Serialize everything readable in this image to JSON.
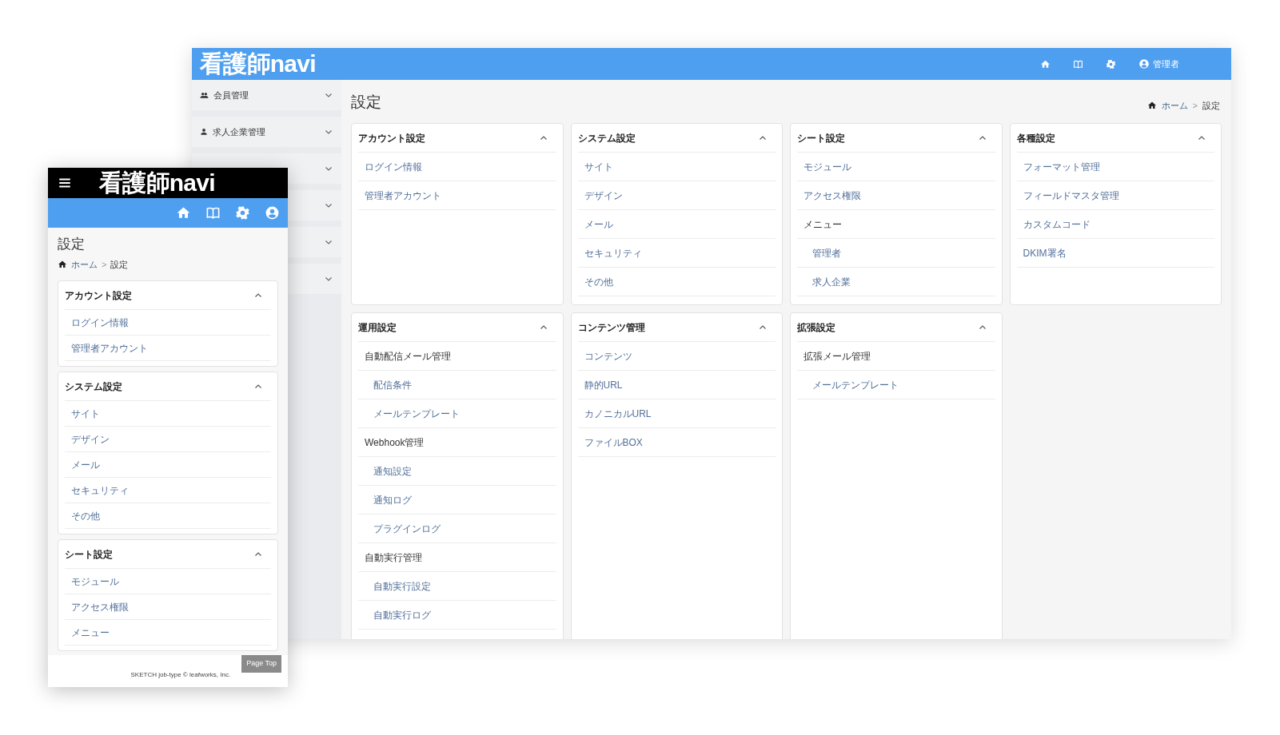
{
  "desktop": {
    "logo": "看護師navi",
    "user": "管理者",
    "sidebar": {
      "items": [
        {
          "label": "会員管理",
          "expanded": false
        },
        {
          "label": "求人企業管理",
          "expanded": false
        },
        {
          "expanded": false
        },
        {
          "expanded": false
        },
        {
          "expanded": false
        },
        {
          "expanded": false
        }
      ]
    },
    "page_title": "設定",
    "breadcrumb": [
      {
        "label": "ホーム",
        "kind": "home"
      },
      {
        "label": "設定",
        "kind": "current",
        "separator": ">"
      }
    ],
    "panels": [
      {
        "title": "アカウント設定",
        "expanded": true,
        "items": [
          {
            "label": "ログイン情報"
          },
          {
            "label": "管理者アカウント"
          }
        ]
      },
      {
        "title": "システム設定",
        "expanded": true,
        "items": [
          {
            "label": "サイト"
          },
          {
            "label": "デザイン"
          },
          {
            "label": "メール"
          },
          {
            "label": "セキュリティ"
          },
          {
            "label": "その他"
          }
        ]
      },
      {
        "title": "シート設定",
        "expanded": true,
        "items": [
          {
            "label": "モジュール"
          },
          {
            "label": "アクセス権限"
          },
          {
            "label": "メニュー",
            "children": [
              {
                "label": "管理者"
              },
              {
                "label": "求人企業"
              }
            ]
          }
        ]
      },
      {
        "title": "各種設定",
        "expanded": true,
        "items": [
          {
            "label": "フォーマット管理"
          },
          {
            "label": "フィールドマスタ管理"
          },
          {
            "label": "カスタムコード"
          },
          {
            "label": "DKIM署名"
          }
        ]
      },
      {
        "title": "運用設定",
        "expanded": true,
        "items": [
          {
            "label": "自動配信メール管理",
            "children": [
              {
                "label": "配信条件"
              },
              {
                "label": "メールテンプレート"
              }
            ]
          },
          {
            "label": "Webhook管理",
            "children": [
              {
                "label": "通知設定"
              },
              {
                "label": "通知ログ"
              },
              {
                "label": "プラグインログ"
              }
            ]
          },
          {
            "label": "自動実行管理",
            "children": [
              {
                "label": "自動実行設定"
              },
              {
                "label": "自動実行ログ"
              }
            ]
          }
        ]
      },
      {
        "title": "コンテンツ管理",
        "expanded": true,
        "items": [
          {
            "label": "コンテンツ"
          },
          {
            "label": "静的URL"
          },
          {
            "label": "カノニカルURL"
          },
          {
            "label": "ファイルBOX"
          }
        ]
      },
      {
        "title": "拡張設定",
        "expanded": true,
        "items": [
          {
            "label": "拡張メール管理",
            "children": [
              {
                "label": "メールテンプレート"
              }
            ]
          }
        ]
      }
    ]
  },
  "mobile": {
    "logo": "看護師navi",
    "page_title": "設定",
    "breadcrumb": [
      {
        "label": "ホーム",
        "kind": "home"
      },
      {
        "label": "設定",
        "kind": "current",
        "separator": ">"
      }
    ],
    "panels": [
      {
        "title": "アカウント設定",
        "expanded": true,
        "items": [
          {
            "label": "ログイン情報"
          },
          {
            "label": "管理者アカウント"
          }
        ]
      },
      {
        "title": "システム設定",
        "expanded": true,
        "items": [
          {
            "label": "サイト"
          },
          {
            "label": "デザイン"
          },
          {
            "label": "メール"
          },
          {
            "label": "セキュリティ"
          },
          {
            "label": "その他"
          }
        ]
      },
      {
        "title": "シート設定",
        "expanded": true,
        "items": [
          {
            "label": "モジュール"
          },
          {
            "label": "アクセス権限"
          },
          {
            "label": "メニュー"
          }
        ]
      }
    ],
    "footer": {
      "copyright": "SKETCH job-type © leafworks, Inc.",
      "page_top": "Page Top"
    }
  }
}
